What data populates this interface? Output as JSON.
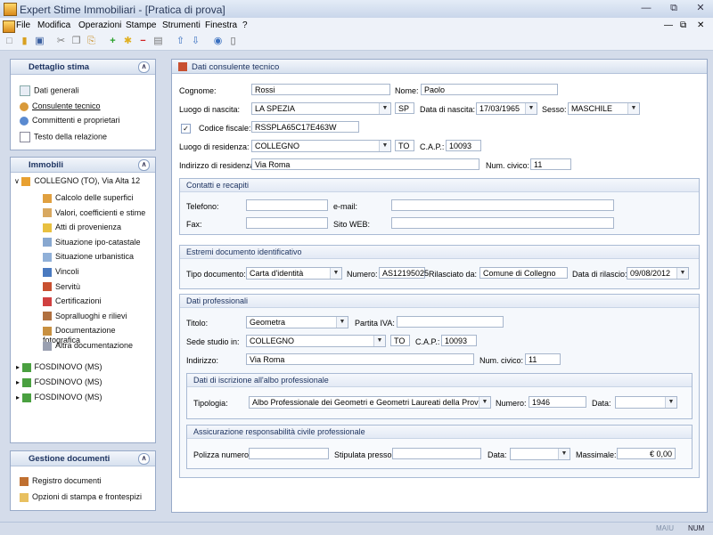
{
  "window": {
    "title": "Expert Stime Immobiliari - [Pratica di prova]"
  },
  "menu": [
    "File",
    "Modifica",
    "Operazioni",
    "Stampe",
    "Strumenti",
    "Finestra",
    "?"
  ],
  "sidebar": {
    "dettaglio": {
      "title": "Dettaglio stima",
      "items": [
        "Dati generali",
        "Consulente tecnico",
        "Committenti e proprietari",
        "Testo della relazione"
      ]
    },
    "immobili": {
      "title": "Immobili",
      "root": "COLLEGNO (TO), Via Alta 12",
      "children": [
        "Calcolo delle superfici",
        "Valori, coefficienti e stime",
        "Atti di provenienza",
        "Situazione ipo-catastale",
        "Situazione urbanistica",
        "Vincoli",
        "Servitù",
        "Certificazioni",
        "Sopralluoghi e rilievi",
        "Documentazione fotografica",
        "Altra documentazione"
      ],
      "others": [
        "FOSDINOVO (MS)",
        "FOSDINOVO (MS)",
        "FOSDINOVO (MS)"
      ]
    },
    "documenti": {
      "title": "Gestione documenti",
      "items": [
        "Registro documenti",
        "Opzioni di stampa e frontespizi"
      ]
    }
  },
  "main": {
    "title": "Dati consulente tecnico",
    "labels": {
      "cognome": "Cognome:",
      "nome": "Nome:",
      "luogo_nascita": "Luogo di nascita:",
      "data_nascita": "Data di nascita:",
      "sesso": "Sesso:",
      "codice_fiscale": "Codice fiscale:",
      "luogo_residenza": "Luogo di residenza:",
      "cap": "C.A.P.:",
      "indirizzo_residenza": "Indirizzo di residenza:",
      "num_civico": "Num. civico:"
    },
    "values": {
      "cognome": "Rossi",
      "nome": "Paolo",
      "luogo_nascita": "LA SPEZIA",
      "prov_nascita": "SP",
      "data_nascita": "17/03/1965",
      "sesso": "MASCHILE",
      "codice_fiscale": "RSSPLA65C17E463W",
      "luogo_residenza": "COLLEGNO",
      "prov_residenza": "TO",
      "cap": "10093",
      "indirizzo": "Via Roma",
      "num_civico": "11"
    },
    "contatti": {
      "title": "Contatti e recapiti",
      "telefono": "Telefono:",
      "email": "e-mail:",
      "fax": "Fax:",
      "sito": "Sito WEB:"
    },
    "documento": {
      "title": "Estremi documento identificativo",
      "tipo_label": "Tipo documento:",
      "tipo": "Carta d'identità",
      "numero_label": "Numero:",
      "numero": "AS12195025",
      "rilasciato_label": "Rilasciato da:",
      "rilasciato": "Comune di Collegno",
      "data_label": "Data di rilascio:",
      "data": "09/08/2012"
    },
    "professionali": {
      "title": "Dati professionali",
      "titolo_label": "Titolo:",
      "titolo": "Geometra",
      "piva_label": "Partita IVA:",
      "sede_label": "Sede studio in:",
      "sede": "COLLEGNO",
      "sede_prov": "TO",
      "cap_label": "C.A.P.:",
      "cap": "10093",
      "indirizzo_label": "Indirizzo:",
      "indirizzo": "Via Roma",
      "civico_label": "Num. civico:",
      "civico": "11",
      "albo": {
        "title": "Dati di iscrizione all'albo professionale",
        "tipologia_label": "Tipologia:",
        "tipologia": "Albo Professionale dei Geometri e Geometri Laureati della Provincia di",
        "numero_label": "Numero:",
        "numero": "1946",
        "data_label": "Data:"
      },
      "assicurazione": {
        "title": "Assicurazione responsabilità civile professionale",
        "polizza_label": "Polizza numero:",
        "stipulata_label": "Stipulata presso:",
        "data_label": "Data:",
        "massimale_label": "Massimale:",
        "massimale": "€ 0,00"
      }
    }
  },
  "status": {
    "maiu": "MAIU",
    "num": "NUM"
  }
}
